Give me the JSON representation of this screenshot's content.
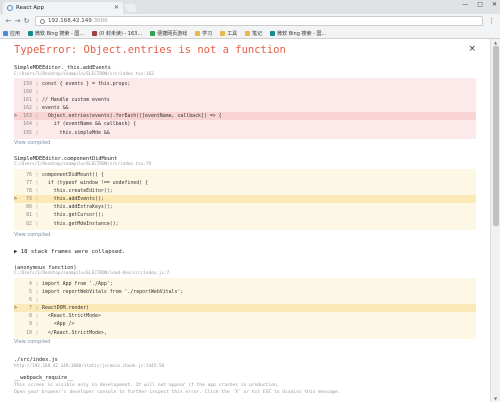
{
  "browser": {
    "tab_title": "React App",
    "url": "192.168.42.149",
    "url_port": ":3000",
    "window_controls": [
      "—",
      "□",
      "✕"
    ]
  },
  "bookmarks": [
    {
      "label": "应用",
      "color": "#4a8cd8"
    },
    {
      "label": "微软 Bing 搜索 - 国...",
      "color": "#138a8a"
    },
    {
      "label": "(0 封未读) - 163...",
      "color": "#a04040"
    },
    {
      "label": "便捷网页游戏",
      "color": "#2ea44f"
    },
    {
      "label": "学习",
      "color": "#e7b84a"
    },
    {
      "label": "工具",
      "color": "#e7b84a"
    },
    {
      "label": "笔记",
      "color": "#e7b84a"
    },
    {
      "label": "微软 Bing 搜索 - 国...",
      "color": "#138a8a"
    }
  ],
  "error": {
    "title": "TypeError: Object.entries is not a function",
    "close_glyph": "×"
  },
  "frames": [
    {
      "name": "SimpleMDEEditor._this.addEvents",
      "path": "C:/Users/1/Desktop/seampile/ELECTRON/src/index.tsx:162",
      "tone": "red",
      "lines": [
        {
          "n": "159",
          "mk": "",
          "hl": false,
          "src": "const { events } = this.props;"
        },
        {
          "n": "160",
          "mk": "",
          "hl": false,
          "src": ""
        },
        {
          "n": "161",
          "mk": "",
          "hl": false,
          "src": "// Handle custom events"
        },
        {
          "n": "162",
          "mk": "",
          "hl": false,
          "src": "events &&"
        },
        {
          "n": "163",
          "mk": ">",
          "hl": true,
          "src": "  Object.entries(events).forEach(([eventName, callback]) => {"
        },
        {
          "n": "164",
          "mk": "",
          "hl": false,
          "src": "    if (eventName && callback) {"
        },
        {
          "n": "165",
          "mk": "",
          "hl": false,
          "src": "      this.simpleMde &&"
        }
      ],
      "view_compiled": "View compiled"
    },
    {
      "name": "SimpleMDEEditor.componentDidMount",
      "path": "C:/Users/1/Desktop/seampile/ELECTRON/src/index.tsx:79",
      "tone": "yellow",
      "lines": [
        {
          "n": "76",
          "mk": "",
          "hl": false,
          "src": "componentDidMount() {"
        },
        {
          "n": "77",
          "mk": "",
          "hl": false,
          "src": "  if (typeof window !== undefined) {"
        },
        {
          "n": "78",
          "mk": "",
          "hl": false,
          "src": "    this.createEditor();"
        },
        {
          "n": "79",
          "mk": ">",
          "hl": true,
          "src": "    this.addEvents();"
        },
        {
          "n": "80",
          "mk": "",
          "hl": false,
          "src": "    this.addExtraKeys();"
        },
        {
          "n": "81",
          "mk": "",
          "hl": false,
          "src": "    this.getCursor();"
        },
        {
          "n": "82",
          "mk": "",
          "hl": false,
          "src": "    this.getMdeInstance();"
        }
      ],
      "view_compiled": "View compiled"
    },
    {
      "name": "(anonymous function)",
      "path": "C:/Users/1/Desktop/seampile/ELECTRON/lead-des/src/index.js:7",
      "tone": "yellow",
      "lines": [
        {
          "n": "4",
          "mk": "",
          "hl": false,
          "src": "import App from './App';"
        },
        {
          "n": "5",
          "mk": "",
          "hl": false,
          "src": "import reportWebVitals from './reportWebVitals';"
        },
        {
          "n": "6",
          "mk": "",
          "hl": false,
          "src": ""
        },
        {
          "n": "7",
          "mk": ">",
          "hl": true,
          "src": "ReactDOM.render("
        },
        {
          "n": "8",
          "mk": "",
          "hl": false,
          "src": "  <React.StrictMode>"
        },
        {
          "n": "9",
          "mk": "",
          "hl": false,
          "src": "    <App />"
        },
        {
          "n": "10",
          "mk": "",
          "hl": false,
          "src": "  </React.StrictMode>,"
        }
      ],
      "view_compiled": "View compiled"
    }
  ],
  "collapsed_text": "▶ 18 stack frames were collapsed.",
  "tail": {
    "name": "./src/index.js",
    "path": "http://192.168.42.149:3000/static/js/main.chunk.js:1445:50",
    "webpack": "__webpack_require__"
  },
  "footer": {
    "line1": "This screen is visible only in development. It will not appear if the app crashes in production.",
    "line2": "Open your browser's developer console to further inspect this error.  Click the 'X' or hit ESC to dismiss this message."
  }
}
